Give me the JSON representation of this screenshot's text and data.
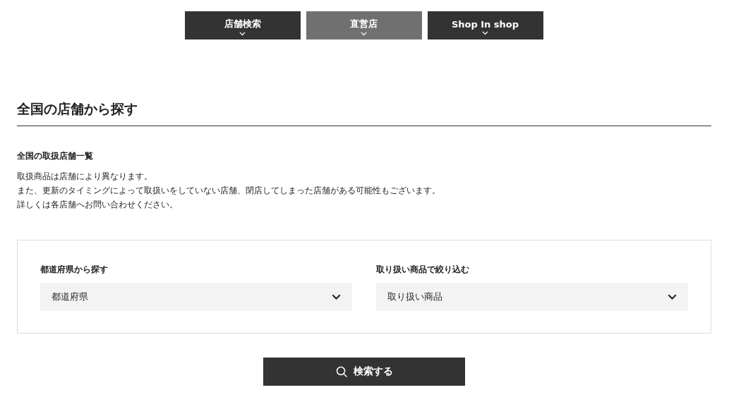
{
  "tabs": [
    {
      "label": "店舗検索",
      "selected": false
    },
    {
      "label": "直営店",
      "selected": true
    },
    {
      "label": "Shop In shop",
      "selected": false
    }
  ],
  "heading": "全国の店舗から探す",
  "subheading": "全国の取扱店舗一覧",
  "notes": [
    "取扱商品は店舗により異なります。",
    "また、更新のタイミングによって取扱いをしていない店舗、閉店してしまった店舗がある可能性もございます。",
    "詳しくは各店舗へお問い合わせください。"
  ],
  "filters": [
    {
      "label": "都道府県から探す",
      "value": "都道府県"
    },
    {
      "label": "取り扱い商品で絞り込む",
      "value": "取り扱い商品"
    }
  ],
  "search_button": "検索する"
}
